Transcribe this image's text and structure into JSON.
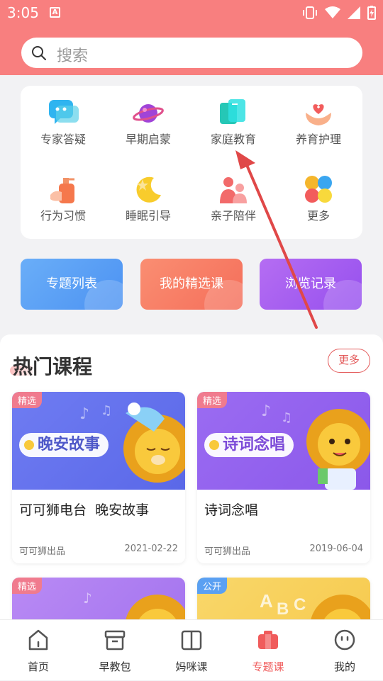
{
  "status_bar": {
    "time": "3:05",
    "notif_letter": "A"
  },
  "search": {
    "placeholder": "搜索"
  },
  "categories": [
    {
      "label": "专家答疑",
      "icon": "chat-bubble-icon"
    },
    {
      "label": "早期启蒙",
      "icon": "planet-icon"
    },
    {
      "label": "家庭教育",
      "icon": "family-book-icon"
    },
    {
      "label": "养育护理",
      "icon": "heart-hand-icon"
    },
    {
      "label": "行为习惯",
      "icon": "lotion-bottle-icon"
    },
    {
      "label": "睡眠引导",
      "icon": "moon-star-icon"
    },
    {
      "label": "亲子陪伴",
      "icon": "parent-child-icon"
    },
    {
      "label": "更多",
      "icon": "colorful-dots-icon"
    }
  ],
  "quick_buttons": [
    {
      "label": "专题列表",
      "color": "#5ba3f6"
    },
    {
      "label": "我的精选课",
      "color": "#f87f6a"
    },
    {
      "label": "浏览记录",
      "color": "#a55bf0"
    }
  ],
  "hot_courses": {
    "title": "热门课程",
    "more_label": "更多",
    "cards": [
      {
        "tag": "精选",
        "banner": "晚安故事",
        "title": "可可狮电台  晚安故事",
        "source": "可可狮出品",
        "date": "2021-02-22"
      },
      {
        "tag": "精选",
        "banner": "诗词念唱",
        "title": "诗词念唱",
        "source": "可可狮出品",
        "date": "2019-06-04"
      },
      {
        "tag": "精选"
      },
      {
        "tag": "公开"
      }
    ]
  },
  "tabbar": [
    {
      "label": "首页",
      "icon": "home-icon"
    },
    {
      "label": "早教包",
      "icon": "box-icon"
    },
    {
      "label": "妈咪课",
      "icon": "book-icon"
    },
    {
      "label": "专题课",
      "icon": "topic-bag-icon",
      "active": true
    },
    {
      "label": "我的",
      "icon": "profile-icon"
    }
  ],
  "colors": {
    "header": "#f87f7f",
    "accent": "#e35a5a",
    "annotation_arrow": "#e04848"
  }
}
